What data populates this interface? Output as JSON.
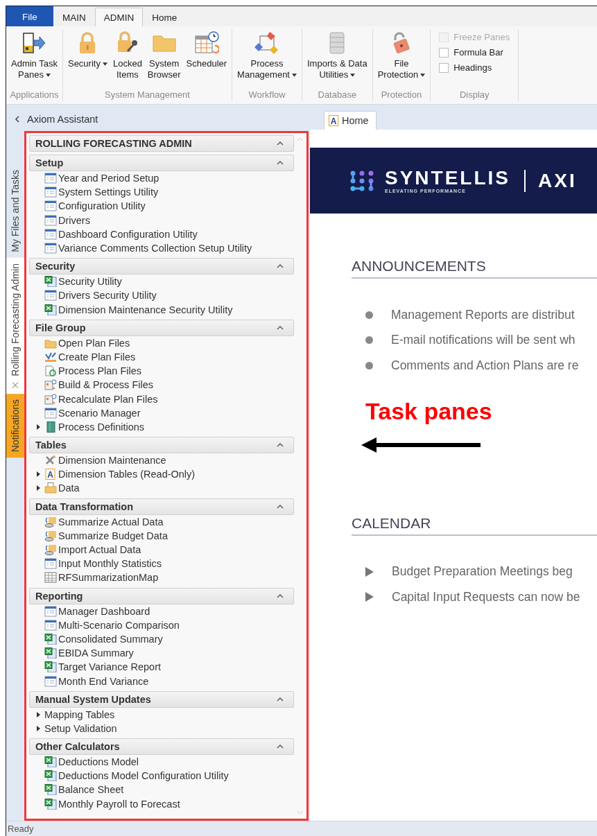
{
  "ribbon_tabs": [
    {
      "label": "File",
      "kind": "file",
      "selected": false
    },
    {
      "label": "MAIN",
      "kind": "tab",
      "selected": false
    },
    {
      "label": "ADMIN",
      "kind": "tab",
      "selected": true
    },
    {
      "label": "Home",
      "kind": "tab",
      "selected": false
    }
  ],
  "ribbon_groups": [
    {
      "label": "Applications",
      "buttons": [
        {
          "lines": [
            "Admin Task",
            "Panes"
          ],
          "kind": "panes",
          "dropdown": true
        }
      ]
    },
    {
      "label": "System Management",
      "buttons": [
        {
          "lines": [
            "Security"
          ],
          "kind": "lock",
          "dropdown": true
        },
        {
          "lines": [
            "Locked",
            "Items"
          ],
          "kind": "lockkey",
          "dropdown": false
        },
        {
          "lines": [
            "System",
            "Browser"
          ],
          "kind": "folder",
          "dropdown": false
        },
        {
          "lines": [
            "Scheduler"
          ],
          "kind": "scheduler",
          "dropdown": false
        }
      ]
    },
    {
      "label": "Workflow",
      "buttons": [
        {
          "lines": [
            "Process",
            "Management"
          ],
          "kind": "process",
          "dropdown": true
        }
      ]
    },
    {
      "label": "Database",
      "buttons": [
        {
          "lines": [
            "Imports & Data",
            "Utilities"
          ],
          "kind": "database",
          "dropdown": true
        }
      ]
    },
    {
      "label": "Protection",
      "buttons": [
        {
          "lines": [
            "File",
            "Protection"
          ],
          "kind": "filelock",
          "dropdown": true
        }
      ]
    },
    {
      "label": "Display",
      "checkboxes": [
        {
          "label": "Freeze Panes",
          "checked": false,
          "disabled": true
        },
        {
          "label": "Formula Bar",
          "checked": false,
          "disabled": false
        },
        {
          "label": "Headings",
          "checked": false,
          "disabled": false
        }
      ]
    }
  ],
  "assistant": {
    "title": "Axiom Assistant"
  },
  "side_tabs": [
    {
      "label": "My Files and Tasks",
      "kind": "plain",
      "selected": false,
      "closable": false
    },
    {
      "label": "Rolling Forecasting Admin",
      "kind": "plain",
      "selected": true,
      "closable": true
    },
    {
      "label": "Notifications",
      "kind": "alert",
      "selected": false,
      "closable": false
    }
  ],
  "task_pane": {
    "title": "ROLLING FORECASTING ADMIN",
    "title_expanded": true,
    "highlighted": true,
    "sections": [
      {
        "title": "Setup",
        "expanded": true,
        "items": [
          {
            "label": "Year and Period Setup",
            "kind": "form",
            "collapsed": false
          },
          {
            "label": "System Settings Utility",
            "kind": "form",
            "collapsed": false
          },
          {
            "label": "Configuration Utility",
            "kind": "form",
            "collapsed": false
          },
          {
            "label": "Drivers",
            "kind": "form",
            "collapsed": false
          },
          {
            "label": "Dashboard Configuration Utility",
            "kind": "form",
            "collapsed": false
          },
          {
            "label": "Variance Comments Collection Setup Utility",
            "kind": "form",
            "collapsed": false
          }
        ]
      },
      {
        "title": "Security",
        "expanded": true,
        "items": [
          {
            "label": "Security Utility",
            "kind": "excel",
            "collapsed": false
          },
          {
            "label": "Drivers Security Utility",
            "kind": "form",
            "collapsed": false
          },
          {
            "label": "Dimension Maintenance Security Utility",
            "kind": "excel",
            "collapsed": false
          }
        ]
      },
      {
        "title": "File Group",
        "expanded": true,
        "items": [
          {
            "label": "Open Plan Files",
            "kind": "folder",
            "collapsed": false
          },
          {
            "label": "Create Plan Files",
            "kind": "create",
            "collapsed": false
          },
          {
            "label": "Process Plan Files",
            "kind": "process",
            "collapsed": false
          },
          {
            "label": "Build & Process Files",
            "kind": "build",
            "collapsed": false
          },
          {
            "label": "Recalculate Plan Files",
            "kind": "build",
            "collapsed": false
          },
          {
            "label": "Scenario Manager",
            "kind": "form",
            "collapsed": false
          },
          {
            "label": "Process Definitions",
            "kind": "book",
            "collapsed": true
          }
        ]
      },
      {
        "title": "Tables",
        "expanded": true,
        "items": [
          {
            "label": "Dimension Maintenance",
            "kind": "tools",
            "collapsed": false
          },
          {
            "label": "Dimension Tables (Read-Only)",
            "kind": "lettera",
            "icon_text": "A",
            "collapsed": true
          },
          {
            "label": "Data",
            "kind": "datafolder",
            "collapsed": true
          }
        ]
      },
      {
        "title": "Data Transformation",
        "expanded": true,
        "items": [
          {
            "label": "Summarize Actual Data",
            "kind": "summarize",
            "collapsed": false
          },
          {
            "label": "Summarize Budget Data",
            "kind": "summarize",
            "collapsed": false
          },
          {
            "label": "Import Actual Data",
            "kind": "summarize",
            "collapsed": false
          },
          {
            "label": "Input Monthly Statistics",
            "kind": "form",
            "collapsed": false
          },
          {
            "label": "RFSummarizationMap",
            "kind": "grid",
            "collapsed": false
          }
        ]
      },
      {
        "title": "Reporting",
        "expanded": true,
        "items": [
          {
            "label": "Manager Dashboard",
            "kind": "form",
            "collapsed": false
          },
          {
            "label": "Multi-Scenario Comparison",
            "kind": "form",
            "collapsed": false
          },
          {
            "label": "Consolidated Summary",
            "kind": "excel",
            "collapsed": false
          },
          {
            "label": "EBIDA Summary",
            "kind": "excel",
            "collapsed": false
          },
          {
            "label": "Target Variance Report",
            "kind": "excel",
            "collapsed": false
          },
          {
            "label": "Month End Variance",
            "kind": "form",
            "collapsed": false
          }
        ]
      },
      {
        "title": "Manual System Updates",
        "expanded": true,
        "items": [
          {
            "label": "Mapping Tables",
            "kind": "none",
            "collapsed": true
          },
          {
            "label": "Setup Validation",
            "kind": "none",
            "collapsed": true
          }
        ]
      },
      {
        "title": "Other Calculators",
        "expanded": true,
        "items": [
          {
            "label": "Deductions Model",
            "kind": "excel",
            "collapsed": false
          },
          {
            "label": "Deductions Model Configuration Utility",
            "kind": "excel",
            "collapsed": false
          },
          {
            "label": "Balance Sheet",
            "kind": "excel",
            "collapsed": false
          },
          {
            "label": "Monthly Payroll to Forecast",
            "kind": "excel",
            "collapsed": false
          }
        ]
      }
    ]
  },
  "document_tabs": [
    {
      "label": "Home",
      "icon_text": "A",
      "selected": true
    }
  ],
  "banner": {
    "brand": "SYNTELLIS",
    "tagline": "ELEVATING PERFORMANCE",
    "product": "AXI"
  },
  "announcements": {
    "title": "ANNOUNCEMENTS",
    "items": [
      "Management Reports are distribut",
      "E-mail notifications will be sent wh",
      "Comments and Action Plans are re"
    ]
  },
  "annotation": {
    "label": "Task panes"
  },
  "calendar": {
    "title": "CALENDAR",
    "items": [
      "Budget Preparation Meetings beg",
      "Capital Input Requests can now be"
    ]
  },
  "status_bar": {
    "text": "Ready"
  }
}
